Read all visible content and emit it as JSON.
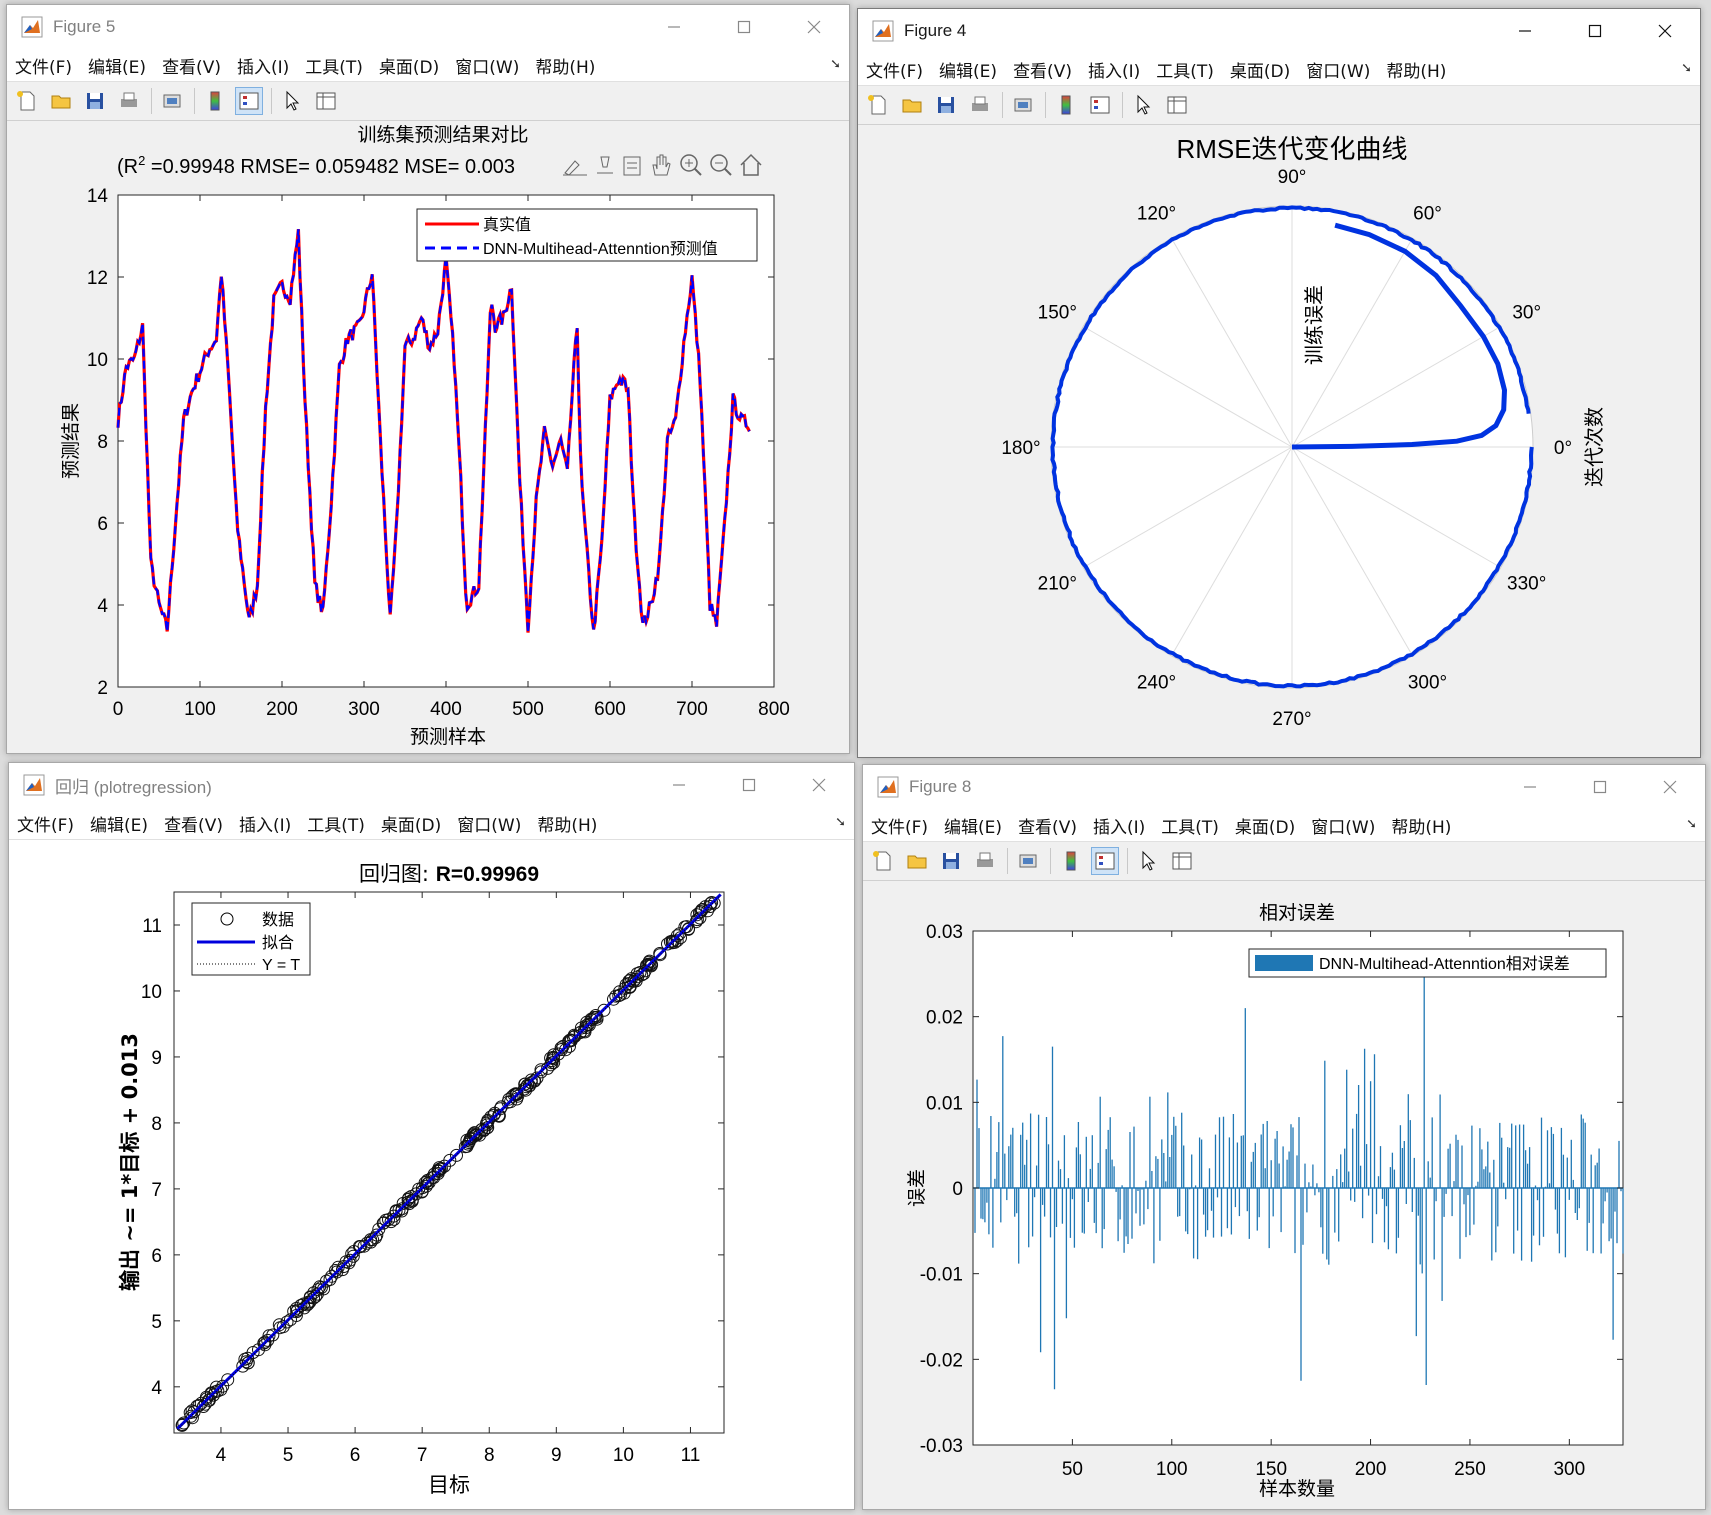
{
  "menu": [
    "文件(F)",
    "编辑(E)",
    "查看(V)",
    "插入(I)",
    "工具(T)",
    "桌面(D)",
    "窗口(W)",
    "帮助(H)"
  ],
  "fig5": {
    "title": "Figure 5",
    "plot_title": "训练集预测结果对比",
    "subtitle": "(R",
    "subtitle_sup": "2",
    "subtitle_rest": " =0.99948 RMSE= 0.059482 MSE= 0.003",
    "xlabel": "预测样本",
    "ylabel": "预测结果",
    "legend": [
      "真实值",
      "DNN-Multihead-Attenntion预测值"
    ],
    "xticks": [
      "0",
      "100",
      "200",
      "300",
      "400",
      "500",
      "600",
      "700",
      "800"
    ],
    "yticks": [
      "2",
      "4",
      "6",
      "8",
      "10",
      "12",
      "14"
    ]
  },
  "fig4": {
    "title": "Figure 4",
    "plot_title": "RMSE迭代变化曲线",
    "angle_labels": [
      "0°",
      "30°",
      "60°",
      "90°",
      "120°",
      "150°",
      "180°",
      "210°",
      "240°",
      "270°",
      "300°",
      "330°"
    ],
    "theta_label": "训练误差",
    "r_label": "迭代次数"
  },
  "reg": {
    "title": "回归 (plotregression)",
    "plot_title_cjk": "回归图: ",
    "plot_title_r": "R=0.99969",
    "xlabel": "目标",
    "ylabel": "输出 ~= 1*目标 + 0.013",
    "legend": [
      "数据",
      "拟合",
      "Y = T"
    ],
    "xticks": [
      "4",
      "5",
      "6",
      "7",
      "8",
      "9",
      "10",
      "11"
    ],
    "yticks": [
      "4",
      "5",
      "6",
      "7",
      "8",
      "9",
      "10",
      "11"
    ]
  },
  "fig8": {
    "title": "Figure 8",
    "plot_title": "相对误差",
    "xlabel": "样本数量",
    "ylabel": "误差",
    "legend": "DNN-Multihead-Attenntion相对误差",
    "xticks": [
      "50",
      "100",
      "150",
      "200",
      "250",
      "300"
    ],
    "yticks": [
      "0.03",
      "0.02",
      "0.01",
      "0",
      "-0.01",
      "-0.02",
      "-0.03"
    ]
  },
  "chart_data": [
    {
      "type": "line",
      "title": "训练集预测结果对比",
      "xlabel": "预测样本",
      "ylabel": "预测结果",
      "xlim": [
        0,
        800
      ],
      "ylim": [
        2,
        14
      ],
      "series": [
        {
          "name": "真实值",
          "color": "#ff0000"
        },
        {
          "name": "DNN-Multihead-Attenntion预测值",
          "color": "#0000ff"
        }
      ],
      "x": [
        0,
        10,
        20,
        30,
        40,
        50,
        60,
        70,
        80,
        90,
        100,
        110,
        120,
        126,
        135,
        145,
        160,
        170,
        180,
        190,
        200,
        210,
        220,
        228,
        240,
        250,
        260,
        270,
        280,
        295,
        310,
        320,
        332,
        340,
        350,
        360,
        370,
        380,
        390,
        400,
        410,
        418,
        425,
        440,
        455,
        460,
        470,
        480,
        490,
        500,
        510,
        520,
        530,
        540,
        548,
        555,
        560,
        565,
        580,
        590,
        600,
        610,
        618,
        622,
        630,
        640,
        650,
        660,
        670,
        680,
        690,
        700,
        710,
        722,
        730,
        740,
        750,
        760,
        770
      ],
      "y": [
        8.5,
        9.8,
        10.0,
        10.8,
        5.0,
        4.0,
        3.4,
        6.0,
        8.5,
        9.2,
        9.7,
        10.2,
        10.5,
        12.1,
        9.5,
        6.0,
        3.6,
        4.5,
        8.8,
        11.4,
        11.8,
        11.5,
        13.1,
        9.0,
        4.5,
        3.8,
        6.5,
        9.8,
        10.5,
        10.8,
        12.1,
        8.0,
        3.6,
        6.0,
        10.3,
        10.5,
        11.0,
        10.3,
        10.7,
        12.4,
        10.0,
        7.0,
        4.0,
        4.5,
        11.5,
        10.8,
        11.0,
        11.8,
        7.0,
        3.5,
        6.5,
        8.2,
        7.4,
        8.0,
        7.2,
        9.5,
        10.8,
        7.0,
        3.3,
        5.5,
        9.0,
        9.5,
        9.4,
        9.2,
        6.0,
        3.5,
        4.0,
        5.0,
        8.0,
        8.5,
        10.4,
        12.0,
        9.5,
        4.0,
        3.5,
        6.0,
        9.0,
        8.5,
        8.4
      ]
    },
    {
      "type": "line",
      "title": "RMSE迭代变化曲线",
      "xlabel": "训练误差",
      "ylabel": "迭代次数",
      "series": [
        {
          "name": "",
          "color": "#0033e0"
        }
      ]
    },
    {
      "type": "scatter",
      "title": "回归图: R=0.99969",
      "xlabel": "目标",
      "ylabel": "输出 ~= 1*目标 + 0.013",
      "xlim": [
        3.3,
        11.5
      ],
      "ylim": [
        3.3,
        11.5
      ],
      "series": [
        {
          "name": "数据",
          "marker": "o",
          "color": "#000000"
        },
        {
          "name": "拟合",
          "line": "solid",
          "color": "#0000dd",
          "slope": 1,
          "intercept": 0.013
        },
        {
          "name": "Y = T",
          "line": "dotted",
          "color": "#000000"
        }
      ]
    },
    {
      "type": "bar",
      "title": "相对误差",
      "xlabel": "样本数量",
      "ylabel": "误差",
      "xlim": [
        0,
        327
      ],
      "ylim": [
        -0.03,
        0.03
      ],
      "series": [
        {
          "name": "DNN-Multihead-Attenntion相对误差",
          "color": "#1f77b4"
        }
      ]
    }
  ]
}
